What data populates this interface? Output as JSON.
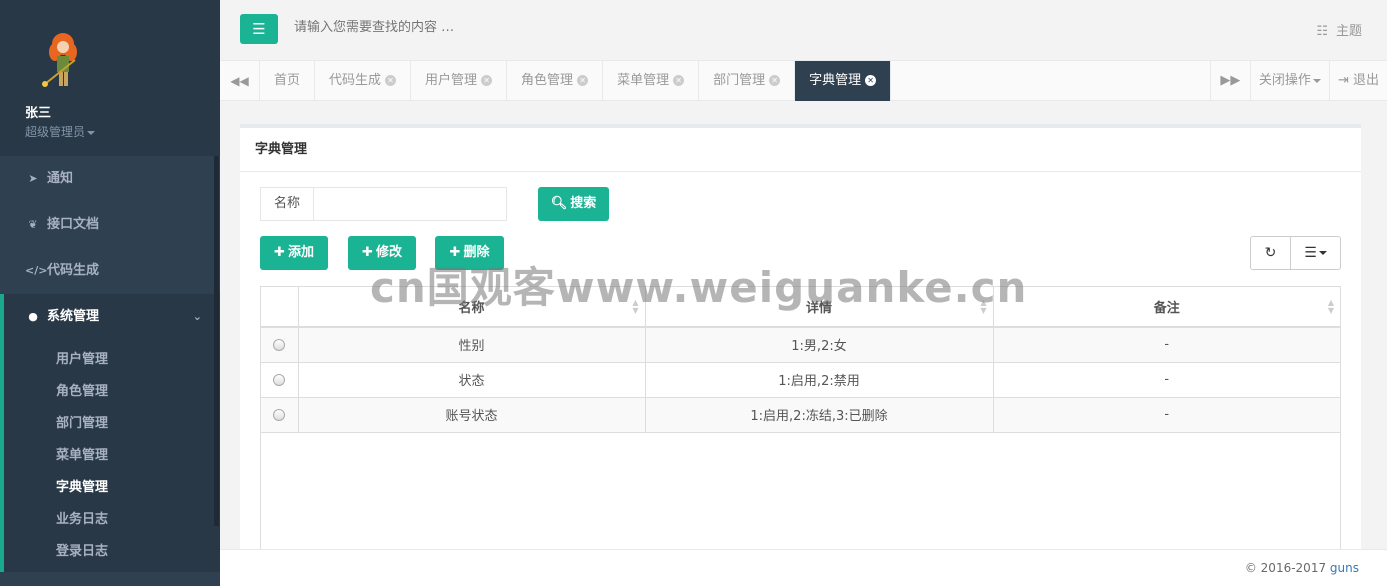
{
  "profile": {
    "name": "张三",
    "role": "超级管理员"
  },
  "sidebar": {
    "items": [
      {
        "label": "通知",
        "icon": "rocket-icon"
      },
      {
        "label": "接口文档",
        "icon": "leaf-icon"
      },
      {
        "label": "代码生成",
        "icon": "code-icon"
      },
      {
        "label": "系统管理",
        "icon": "user-icon"
      }
    ],
    "submenu": [
      "用户管理",
      "角色管理",
      "部门管理",
      "菜单管理",
      "字典管理",
      "业务日志",
      "登录日志"
    ]
  },
  "topbar": {
    "search_placeholder": "请输入您需要查找的内容 …",
    "theme_label": "主题"
  },
  "tabs": {
    "items": [
      "首页",
      "代码生成",
      "用户管理",
      "角色管理",
      "菜单管理",
      "部门管理",
      "字典管理"
    ],
    "close_ops": "关闭操作",
    "logout": "退出"
  },
  "panel": {
    "title": "字典管理"
  },
  "search": {
    "label": "名称",
    "value": "",
    "button": "搜索"
  },
  "actions": {
    "add": "添加",
    "edit": "修改",
    "delete": "删除"
  },
  "table": {
    "headers": [
      "名称",
      "详情",
      "备注"
    ],
    "rows": [
      [
        "性别",
        "1:男,2:女",
        "-"
      ],
      [
        "状态",
        "1:启用,2:禁用",
        "-"
      ],
      [
        "账号状态",
        "1:启用,2:冻结,3:已删除",
        "-"
      ]
    ]
  },
  "watermark": "cn国观客www.weiguanke.cn",
  "footer": {
    "copyright": "© 2016-2017 ",
    "brand": "guns"
  },
  "colors": {
    "accent": "#1ab394",
    "sidebar": "#2f4050",
    "sidebar_dark": "#293846"
  }
}
